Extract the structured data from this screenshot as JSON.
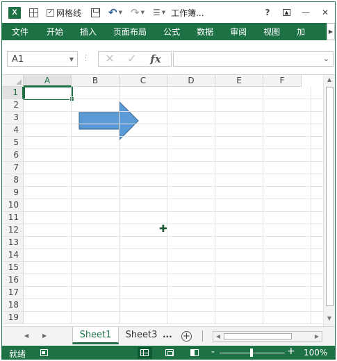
{
  "window": {
    "title": "工作簿...",
    "app_logo": "X",
    "gridlines_label": "网格线",
    "gridlines_checked": true,
    "help": "?",
    "minimize": "—",
    "close": "✕"
  },
  "ribbon": {
    "tabs": [
      {
        "label": "文件"
      },
      {
        "label": "开始"
      },
      {
        "label": "插入"
      },
      {
        "label": "页面布局"
      },
      {
        "label": "公式"
      },
      {
        "label": "数据"
      },
      {
        "label": "审阅"
      },
      {
        "label": "视图"
      },
      {
        "label": "加"
      }
    ]
  },
  "formula_bar": {
    "name_box": "A1",
    "fx_label": "fx",
    "value": ""
  },
  "grid": {
    "columns": [
      "A",
      "B",
      "C",
      "D",
      "E",
      "F"
    ],
    "rows": [
      "1",
      "2",
      "3",
      "4",
      "5",
      "6",
      "7",
      "8",
      "9",
      "10",
      "11",
      "12",
      "13",
      "14",
      "15",
      "16",
      "17",
      "18",
      "19"
    ],
    "active_cell": "A1",
    "arrow_color": "#5b9bd5"
  },
  "sheets": {
    "tabs": [
      {
        "label": "Sheet1",
        "active": true
      },
      {
        "label": "Sheet3",
        "active": false
      }
    ],
    "more_label": "...",
    "add_label": "+"
  },
  "status": {
    "text": "就绪",
    "zoom_level": "100%",
    "zoom_minus": "-",
    "zoom_plus": "+"
  },
  "colors": {
    "accent": "#1e7145",
    "selection": "#1e7145"
  }
}
